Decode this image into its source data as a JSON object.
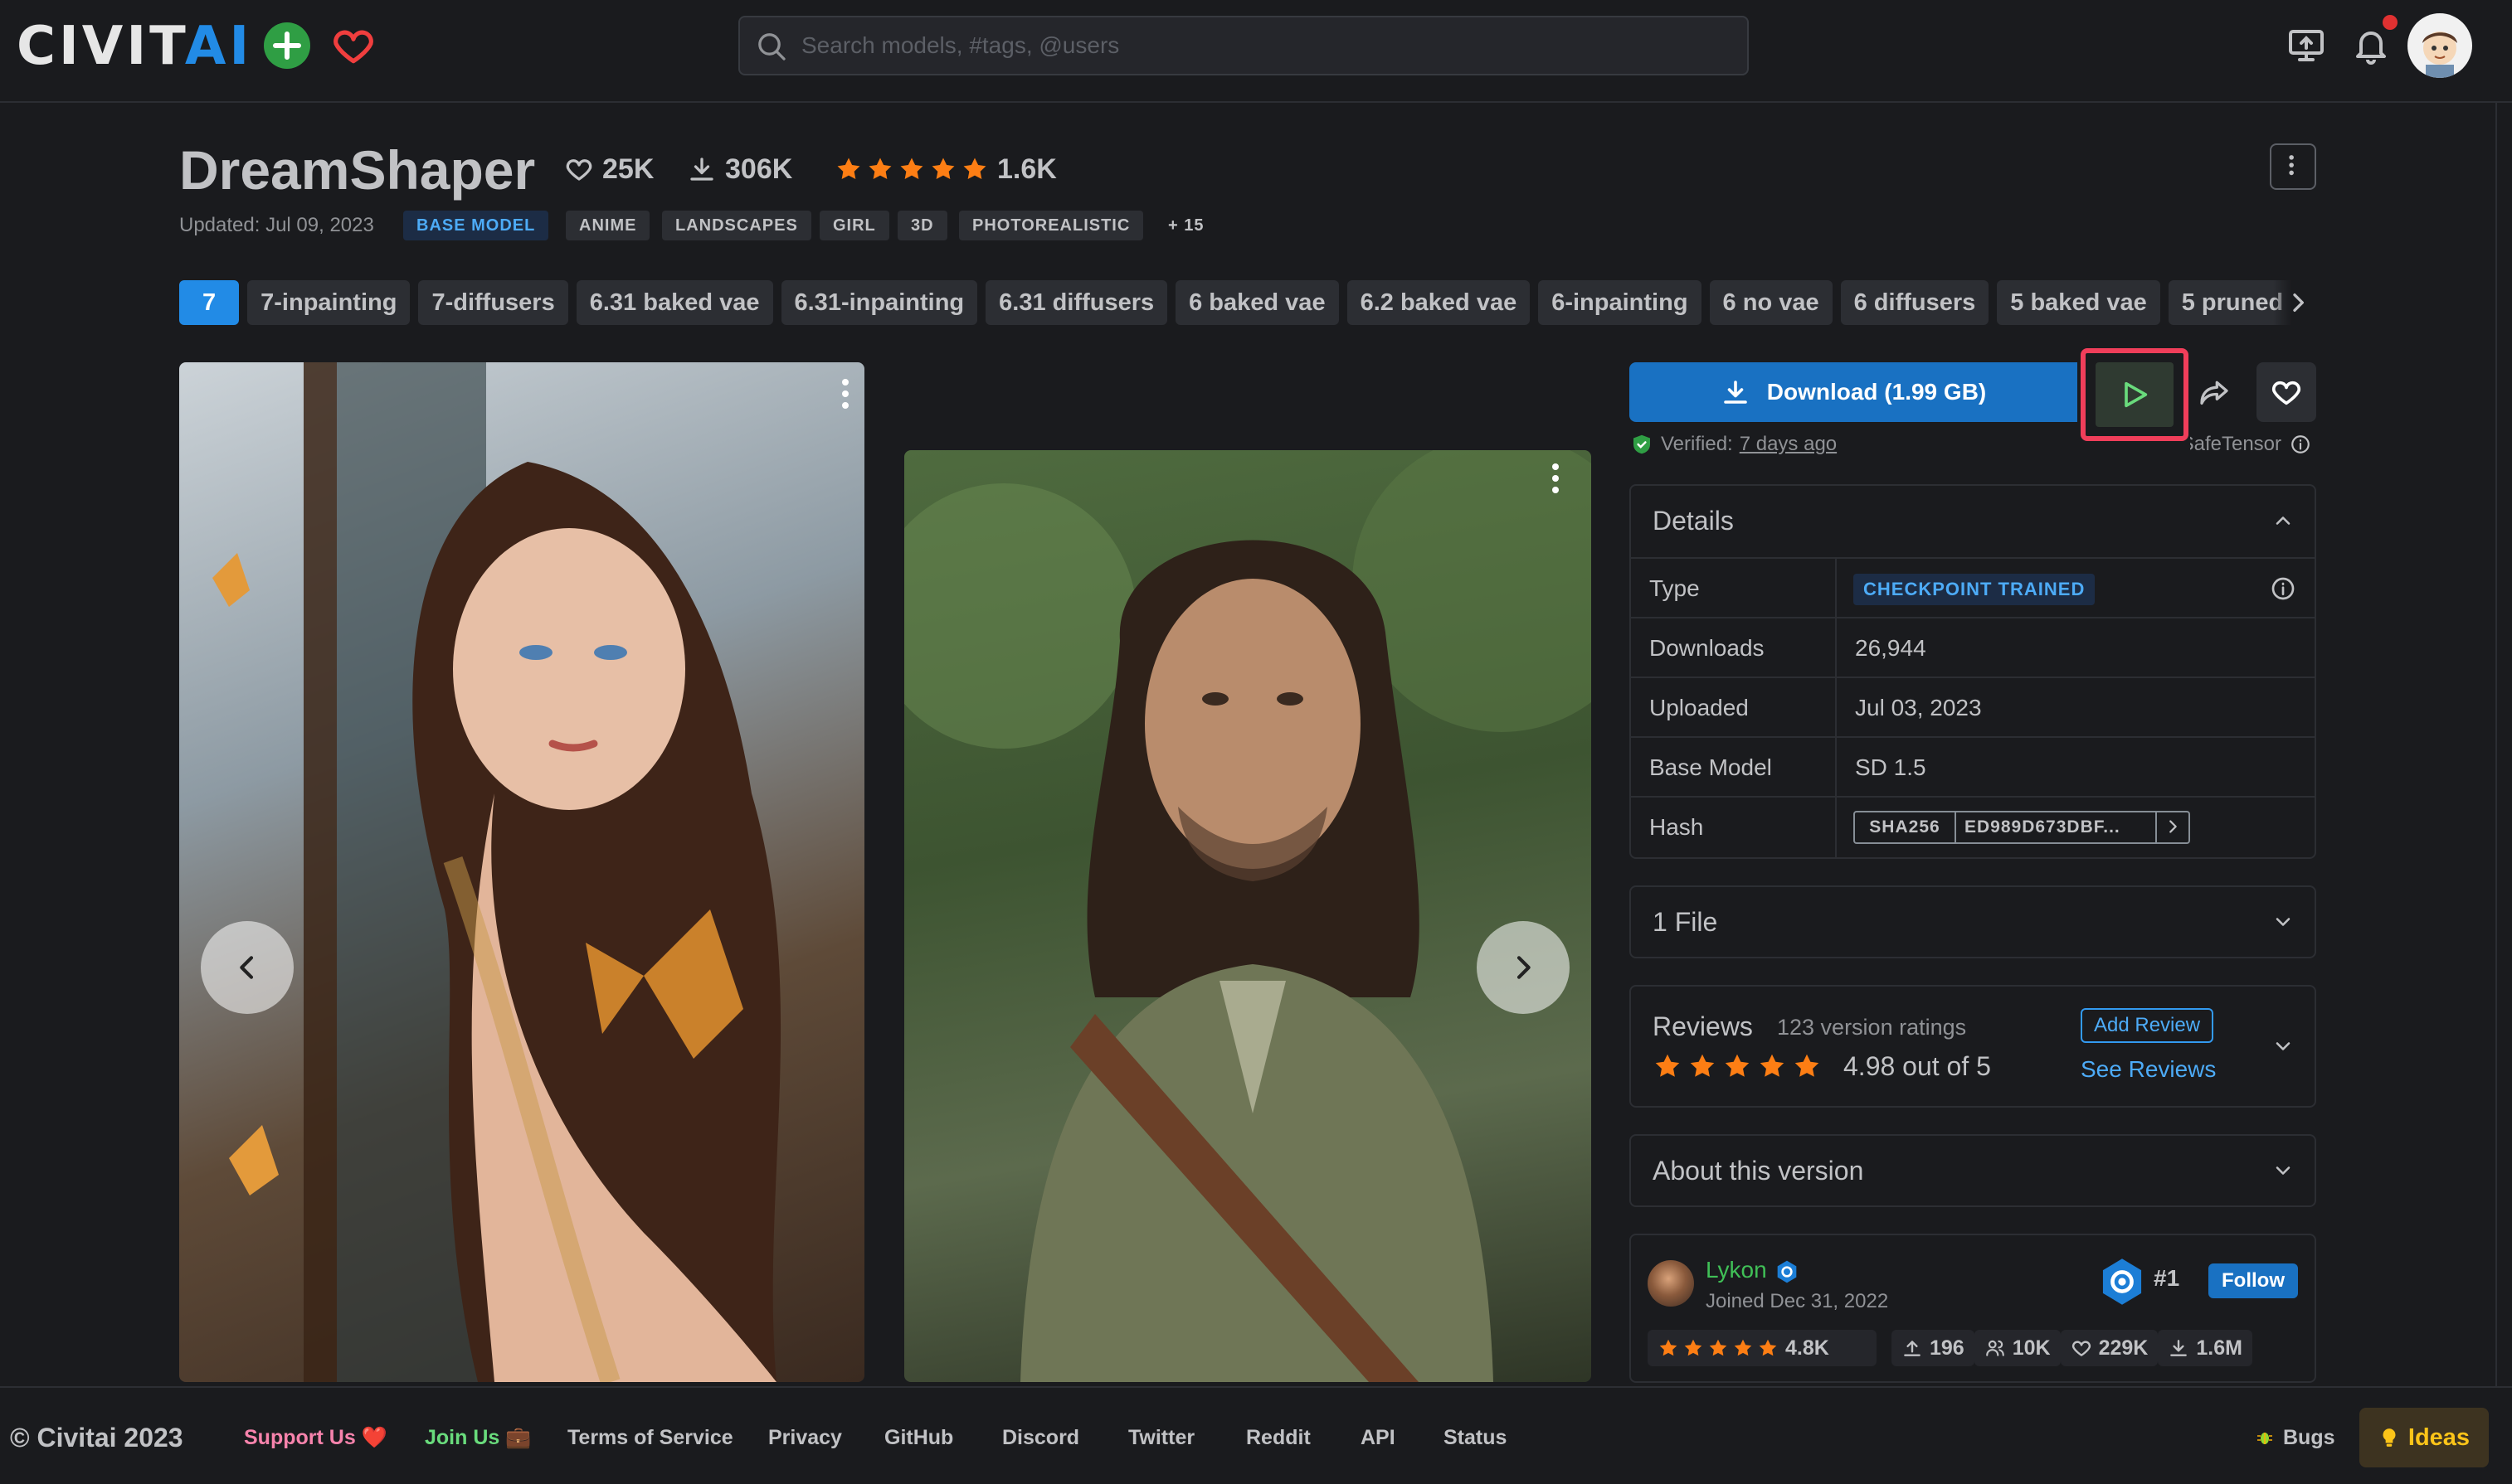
{
  "header": {
    "logo_prefix": "CIVIT",
    "logo_suffix": "AI",
    "search_placeholder": "Search models, #tags, @users"
  },
  "model": {
    "title": "DreamShaper",
    "likes": "25K",
    "downloads": "306K",
    "rating_count": "1.6K",
    "rating_stars": 5,
    "updated": "Updated: Jul 09, 2023",
    "tags": [
      "BASE MODEL",
      "ANIME",
      "LANDSCAPES",
      "GIRL",
      "3D",
      "PHOTOREALISTIC",
      "+ 15"
    ]
  },
  "versions": [
    "7",
    "7-inpainting",
    "7-diffusers",
    "6.31 baked vae",
    "6.31-inpainting",
    "6.31 diffusers",
    "6 baked vae",
    "6.2 baked vae",
    "6-inpainting",
    "6 no vae",
    "6 diffusers",
    "5 baked vae",
    "5 pruned"
  ],
  "actions": {
    "download_label": "Download (1.99 GB)",
    "verified_prefix": "Verified:",
    "verified_when": "7 days ago",
    "format": "SafeTensor"
  },
  "details": {
    "heading": "Details",
    "rows": [
      {
        "key": "Type",
        "value": "CHECKPOINT TRAINED"
      },
      {
        "key": "Downloads",
        "value": "26,944"
      },
      {
        "key": "Uploaded",
        "value": "Jul 03, 2023"
      },
      {
        "key": "Base Model",
        "value": "SD 1.5"
      },
      {
        "key": "Hash",
        "value": "ED989D673DBF..."
      }
    ],
    "hash_type": "SHA256"
  },
  "files": {
    "heading": "1 File"
  },
  "reviews": {
    "heading": "Reviews",
    "count": "123 version ratings",
    "score": "4.98 out of 5",
    "stars": 5,
    "add_label": "Add Review",
    "see_label": "See Reviews"
  },
  "about": {
    "heading": "About this version"
  },
  "creator": {
    "name": "Lykon",
    "joined": "Joined Dec 31, 2022",
    "rank": "#1",
    "follow_label": "Follow",
    "rating": "4.8K",
    "uploads": "196",
    "followers": "10K",
    "likes": "229K",
    "downloads": "1.6M"
  },
  "footer": {
    "copyright": "© Civitai 2023",
    "links": [
      "Support Us ❤️",
      "Join Us 💼",
      "Terms of Service",
      "Privacy",
      "GitHub",
      "Discord",
      "Twitter",
      "Reddit",
      "API",
      "Status"
    ],
    "bugs": "Bugs",
    "ideas": "Ideas"
  },
  "colors": {
    "background": "#1a1b1e",
    "accent_blue": "#1971c2",
    "star_orange": "#fd7e14",
    "highlight_red": "#f03e5a",
    "creator_green": "#40c057"
  }
}
